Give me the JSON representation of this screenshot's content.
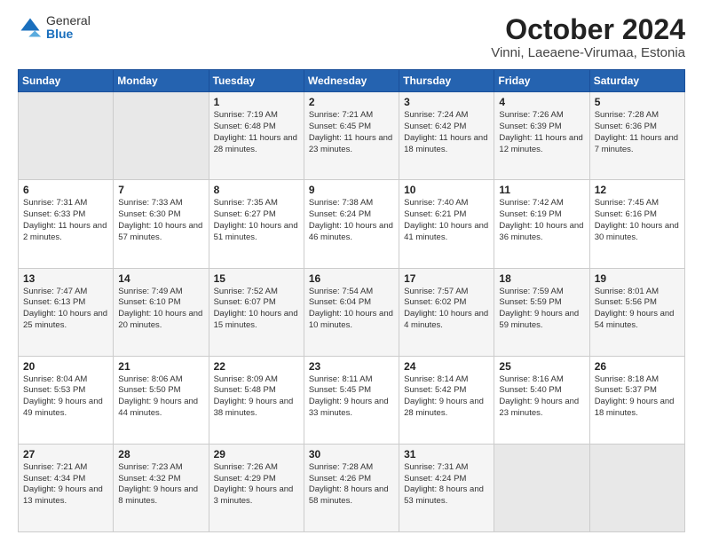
{
  "header": {
    "logo": {
      "general": "General",
      "blue": "Blue"
    },
    "title": "October 2024",
    "subtitle": "Vinni, Laeaene-Virumaa, Estonia"
  },
  "calendar": {
    "headers": [
      "Sunday",
      "Monday",
      "Tuesday",
      "Wednesday",
      "Thursday",
      "Friday",
      "Saturday"
    ],
    "weeks": [
      [
        {
          "day": "",
          "info": ""
        },
        {
          "day": "",
          "info": ""
        },
        {
          "day": "1",
          "info": "Sunrise: 7:19 AM\nSunset: 6:48 PM\nDaylight: 11 hours and 28 minutes."
        },
        {
          "day": "2",
          "info": "Sunrise: 7:21 AM\nSunset: 6:45 PM\nDaylight: 11 hours and 23 minutes."
        },
        {
          "day": "3",
          "info": "Sunrise: 7:24 AM\nSunset: 6:42 PM\nDaylight: 11 hours and 18 minutes."
        },
        {
          "day": "4",
          "info": "Sunrise: 7:26 AM\nSunset: 6:39 PM\nDaylight: 11 hours and 12 minutes."
        },
        {
          "day": "5",
          "info": "Sunrise: 7:28 AM\nSunset: 6:36 PM\nDaylight: 11 hours and 7 minutes."
        }
      ],
      [
        {
          "day": "6",
          "info": "Sunrise: 7:31 AM\nSunset: 6:33 PM\nDaylight: 11 hours and 2 minutes."
        },
        {
          "day": "7",
          "info": "Sunrise: 7:33 AM\nSunset: 6:30 PM\nDaylight: 10 hours and 57 minutes."
        },
        {
          "day": "8",
          "info": "Sunrise: 7:35 AM\nSunset: 6:27 PM\nDaylight: 10 hours and 51 minutes."
        },
        {
          "day": "9",
          "info": "Sunrise: 7:38 AM\nSunset: 6:24 PM\nDaylight: 10 hours and 46 minutes."
        },
        {
          "day": "10",
          "info": "Sunrise: 7:40 AM\nSunset: 6:21 PM\nDaylight: 10 hours and 41 minutes."
        },
        {
          "day": "11",
          "info": "Sunrise: 7:42 AM\nSunset: 6:19 PM\nDaylight: 10 hours and 36 minutes."
        },
        {
          "day": "12",
          "info": "Sunrise: 7:45 AM\nSunset: 6:16 PM\nDaylight: 10 hours and 30 minutes."
        }
      ],
      [
        {
          "day": "13",
          "info": "Sunrise: 7:47 AM\nSunset: 6:13 PM\nDaylight: 10 hours and 25 minutes."
        },
        {
          "day": "14",
          "info": "Sunrise: 7:49 AM\nSunset: 6:10 PM\nDaylight: 10 hours and 20 minutes."
        },
        {
          "day": "15",
          "info": "Sunrise: 7:52 AM\nSunset: 6:07 PM\nDaylight: 10 hours and 15 minutes."
        },
        {
          "day": "16",
          "info": "Sunrise: 7:54 AM\nSunset: 6:04 PM\nDaylight: 10 hours and 10 minutes."
        },
        {
          "day": "17",
          "info": "Sunrise: 7:57 AM\nSunset: 6:02 PM\nDaylight: 10 hours and 4 minutes."
        },
        {
          "day": "18",
          "info": "Sunrise: 7:59 AM\nSunset: 5:59 PM\nDaylight: 9 hours and 59 minutes."
        },
        {
          "day": "19",
          "info": "Sunrise: 8:01 AM\nSunset: 5:56 PM\nDaylight: 9 hours and 54 minutes."
        }
      ],
      [
        {
          "day": "20",
          "info": "Sunrise: 8:04 AM\nSunset: 5:53 PM\nDaylight: 9 hours and 49 minutes."
        },
        {
          "day": "21",
          "info": "Sunrise: 8:06 AM\nSunset: 5:50 PM\nDaylight: 9 hours and 44 minutes."
        },
        {
          "day": "22",
          "info": "Sunrise: 8:09 AM\nSunset: 5:48 PM\nDaylight: 9 hours and 38 minutes."
        },
        {
          "day": "23",
          "info": "Sunrise: 8:11 AM\nSunset: 5:45 PM\nDaylight: 9 hours and 33 minutes."
        },
        {
          "day": "24",
          "info": "Sunrise: 8:14 AM\nSunset: 5:42 PM\nDaylight: 9 hours and 28 minutes."
        },
        {
          "day": "25",
          "info": "Sunrise: 8:16 AM\nSunset: 5:40 PM\nDaylight: 9 hours and 23 minutes."
        },
        {
          "day": "26",
          "info": "Sunrise: 8:18 AM\nSunset: 5:37 PM\nDaylight: 9 hours and 18 minutes."
        }
      ],
      [
        {
          "day": "27",
          "info": "Sunrise: 7:21 AM\nSunset: 4:34 PM\nDaylight: 9 hours and 13 minutes."
        },
        {
          "day": "28",
          "info": "Sunrise: 7:23 AM\nSunset: 4:32 PM\nDaylight: 9 hours and 8 minutes."
        },
        {
          "day": "29",
          "info": "Sunrise: 7:26 AM\nSunset: 4:29 PM\nDaylight: 9 hours and 3 minutes."
        },
        {
          "day": "30",
          "info": "Sunrise: 7:28 AM\nSunset: 4:26 PM\nDaylight: 8 hours and 58 minutes."
        },
        {
          "day": "31",
          "info": "Sunrise: 7:31 AM\nSunset: 4:24 PM\nDaylight: 8 hours and 53 minutes."
        },
        {
          "day": "",
          "info": ""
        },
        {
          "day": "",
          "info": ""
        }
      ]
    ]
  }
}
